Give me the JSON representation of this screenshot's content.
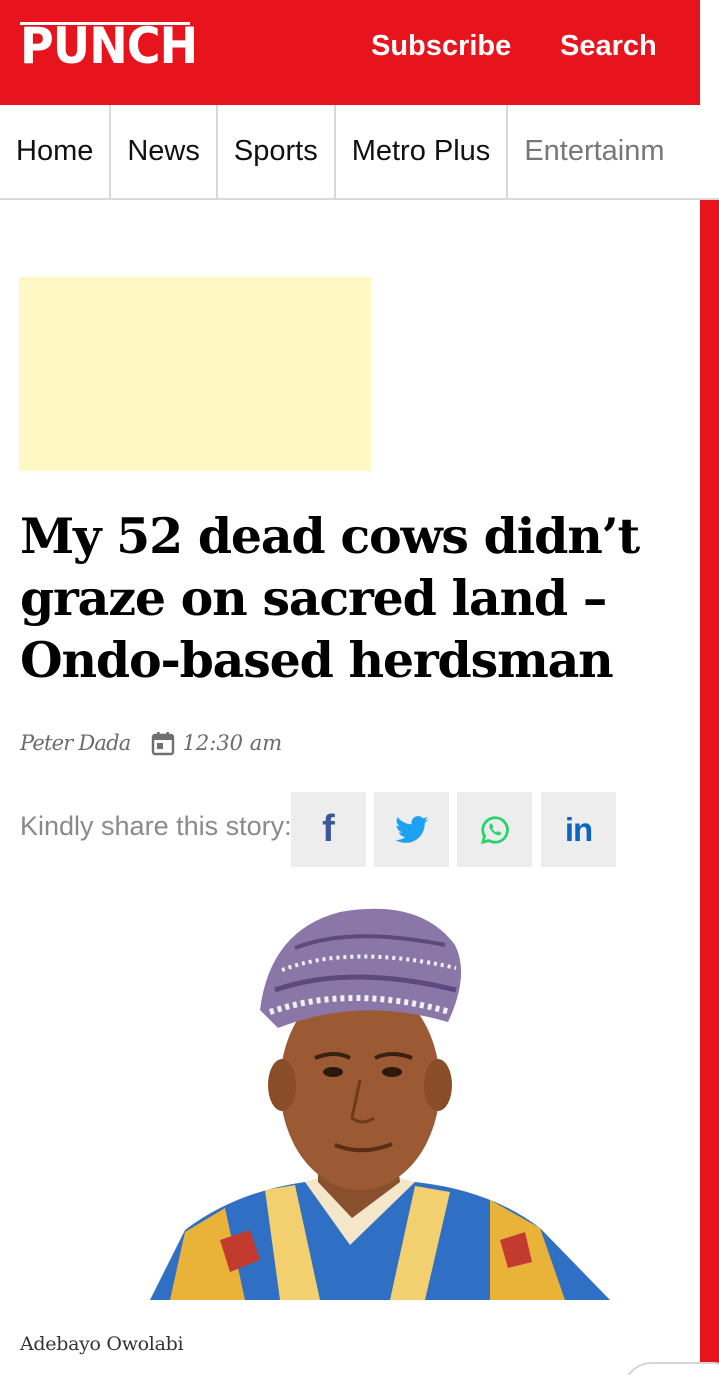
{
  "header": {
    "logo_text": "PUNCH",
    "subscribe_label": "Subscribe",
    "search_label": "Search",
    "brand_color": "#e7141d"
  },
  "nav": {
    "items": [
      "Home",
      "News",
      "Sports",
      "Metro Plus",
      "Entertainm"
    ]
  },
  "article": {
    "headline": "My 52 dead cows didn’t graze on sacred land – Ondo-based herdsman",
    "author": "Peter Dada",
    "time": "12:30 am",
    "share_label": "Kindly share this story:",
    "share_icons": [
      "facebook-icon",
      "twitter-icon",
      "whatsapp-icon",
      "linkedin-icon"
    ],
    "photo_caption": "Adebayo Owolabi"
  }
}
